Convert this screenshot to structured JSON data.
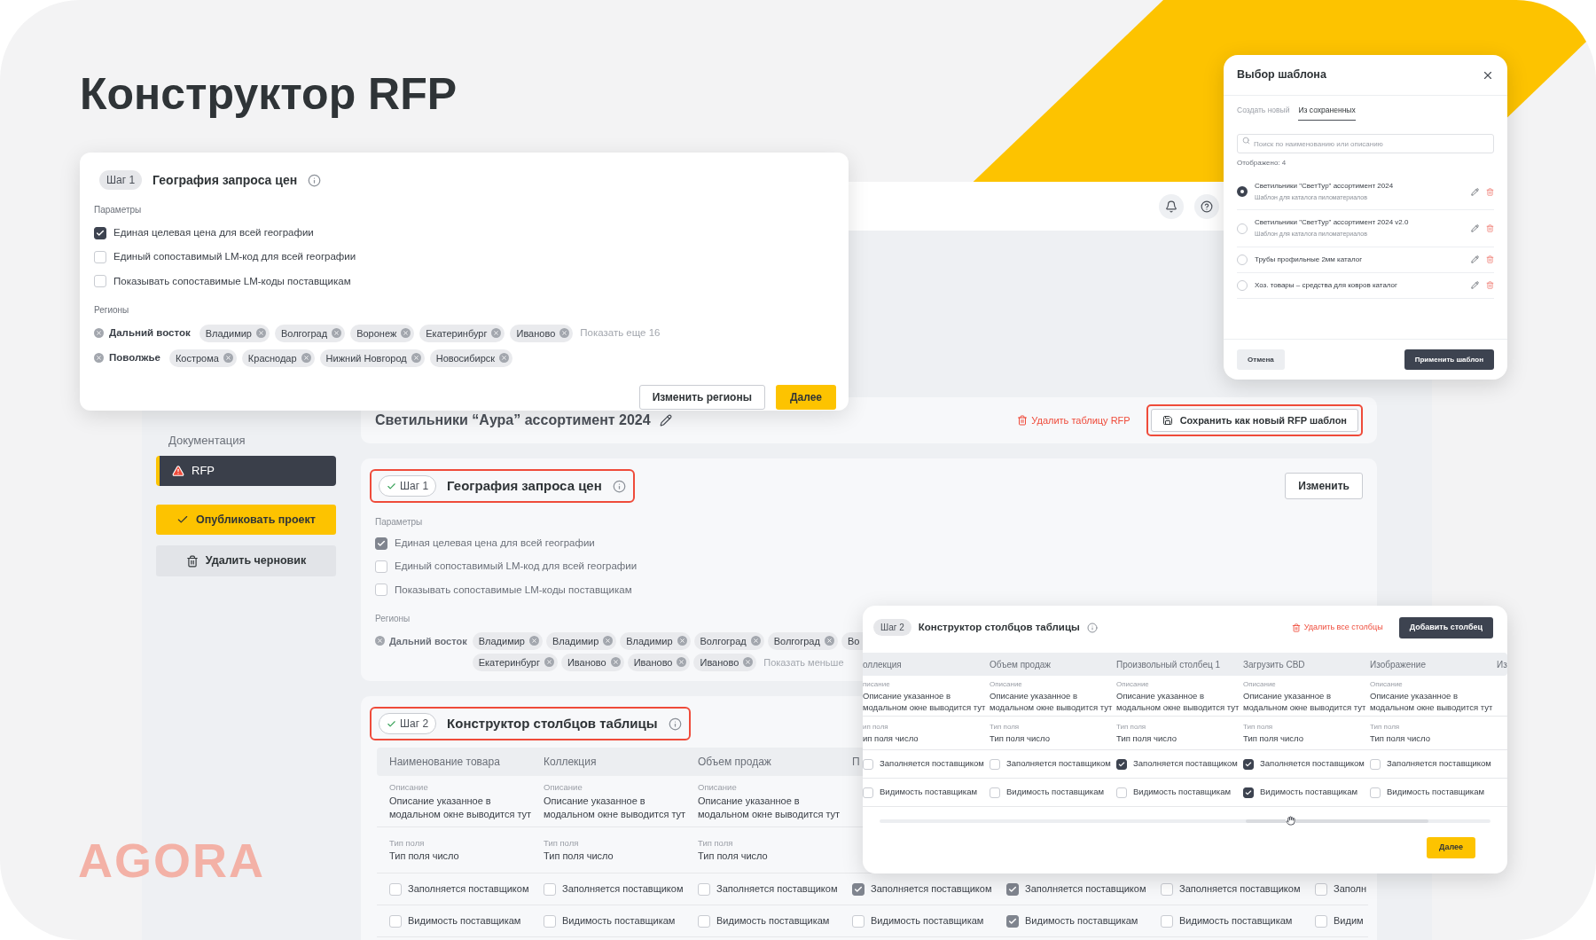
{
  "title": "Конструктор RFP",
  "logo": "AGORA",
  "app": {
    "sidebar": {
      "items": [
        {
          "label": "Документация",
          "selected": false,
          "kind": "link"
        },
        {
          "label": "RFP",
          "selected": true,
          "kind": "warning"
        }
      ],
      "publish_button": "Опубликовать проект",
      "delete_button": "Удалить черновик"
    },
    "header": {
      "title": "Светильники “Аура” ассортимент 2024",
      "delete_link": "Удалить таблицу RFP",
      "save_button": {
        "label": "Сохранить как новый RFP шаблон",
        "highlighted": true
      }
    },
    "step1": {
      "badge": "Шаг 1",
      "done": true,
      "highlighted": true,
      "title": "География запроса цен",
      "edit_button": "Изменить",
      "params_label": "Параметры",
      "options": [
        {
          "label": "Единая целевая цена для всей географии",
          "checked": true
        },
        {
          "label": "Единый сопоставимый LM-код для всей географии",
          "checked": false
        },
        {
          "label": "Показывать сопоставимые LM-коды поставщикам",
          "checked": false
        }
      ],
      "regions_label": "Регионы",
      "region": "Дальний восток",
      "chip_rows": [
        [
          "Владимир",
          "Владимир",
          "Владимир",
          "Волгоград",
          "Волгоград",
          "Во"
        ],
        [
          "Екатеринбург",
          "Иваново",
          "Иваново",
          "Иваново"
        ]
      ],
      "less": "Показать меньше"
    },
    "step2": {
      "badge": "Шаг 2",
      "done": true,
      "highlighted": true,
      "title": "Конструктор столбцов таблицы",
      "columns": [
        {
          "header": "Наименование товара",
          "description_label": "Описание",
          "description": "Описание указанное в модальном окне выводится тут",
          "type_label": "Тип поля",
          "type": "Тип поля число",
          "filled_label": "Заполняется поставщиком",
          "filled": false,
          "visible_label": "Видимость поставщикам",
          "visible": false
        },
        {
          "header": "Коллекция",
          "description_label": "Описание",
          "description": "Описание указанное в модальном окне выводится тут",
          "type_label": "Тип поля",
          "type": "Тип поля число",
          "filled_label": "Заполняется поставщиком",
          "filled": false,
          "visible_label": "Видимость поставщикам",
          "visible": false
        },
        {
          "header": "Объем продаж",
          "description_label": "Описание",
          "description": "Описание указанное в модальном окне выводится тут",
          "type_label": "Тип поля",
          "type": "Тип поля число",
          "filled_label": "Заполняется поставщиком",
          "filled": false,
          "visible_label": "Видимость поставщикам",
          "visible": false
        },
        {
          "header": "П",
          "filled_label": "Заполняется поставщиком",
          "filled": true,
          "visible_label": "Видимость поставщикам",
          "visible": false
        },
        {
          "filled_label": "Заполняется поставщиком",
          "filled": true,
          "visible_label": "Видимость поставщикам",
          "visible": true
        },
        {
          "filled_label": "Заполняется поставщиком",
          "filled": false,
          "visible_label": "Видимость поставщикам",
          "visible": false
        },
        {
          "filled_label": "Заполн",
          "filled": false,
          "visible_label": "Видим",
          "visible": false
        }
      ]
    }
  },
  "geo_card": {
    "badge": "Шаг 1",
    "done": false,
    "title": "География запроса цен",
    "params_label": "Параметры",
    "options": [
      {
        "label": "Единая целевая цена для всей географии",
        "checked": true
      },
      {
        "label": "Единый сопоставимый LM-код для всей географии",
        "checked": false
      },
      {
        "label": "Показывать сопоставимые LM-коды поставщикам",
        "checked": false
      }
    ],
    "regions_label": "Регионы",
    "regions": [
      {
        "name": "Дальний восток",
        "chips": [
          "Владимир",
          "Волгоград",
          "Воронеж",
          "Екатеринбург",
          "Иваново"
        ],
        "more": "Показать еще 16"
      },
      {
        "name": "Поволжье",
        "chips": [
          "Кострома",
          "Краснодар",
          "Нижний Новгород",
          "Новосибирск"
        ]
      }
    ],
    "buttons": [
      {
        "label": "Изменить регионы",
        "kind": "outline"
      },
      {
        "label": "Далее",
        "kind": "primary"
      }
    ]
  },
  "template_modal": {
    "title": "Выбор шаблона",
    "tabs": [
      {
        "label": "Создать новый",
        "selected": false
      },
      {
        "label": "Из сохраненных",
        "selected": true
      }
    ],
    "search": {
      "placeholder": "Поиск по наименованию или описанию"
    },
    "count": "Отображено: 4",
    "templates": [
      {
        "name": "Светильники \"СветТур\" ассортимент 2024",
        "description": "Шаблон для каталога пиломатериалов",
        "selected": true
      },
      {
        "name": "Светильники \"СветТур\" ассортимент 2024 v2.0",
        "description": "Шаблон для каталога пиломатериалов",
        "selected": false
      },
      {
        "name": "Трубы профильные 2мм каталог",
        "selected": false
      },
      {
        "name": "Хоз. товары – средства для ковров каталог",
        "selected": false
      }
    ],
    "cancel_button": "Отмена",
    "apply_button": "Применить шаблон"
  },
  "columns_card": {
    "badge": "Шаг 2",
    "done": false,
    "title": "Конструктор столбцов таблицы",
    "delete_link": "Удалить все столбцы",
    "add_button": "Добавить столбец",
    "columns": [
      {
        "header": "оллекция",
        "description_label": "писание",
        "description": "Описание указанное в модальном окне выводится тут",
        "type_label": "ип поля",
        "type": "ип поля число",
        "filled_label": "Заполняется поставщиком",
        "filled": false,
        "visible_label": "Видимость поставщикам",
        "visible": false
      },
      {
        "header": "Объем продаж",
        "description_label": "Описание",
        "description": "Описание указанное в модальном окне выводится тут",
        "type_label": "Тип поля",
        "type": "Тип поля число",
        "filled_label": "Заполняется поставщиком",
        "filled": false,
        "visible_label": "Видимость поставщикам",
        "visible": false
      },
      {
        "header": "Произвольный столбец 1",
        "description_label": "Описание",
        "description": "Описание указанное в модальном окне выводится тут",
        "type_label": "Тип поля",
        "type": "Тип поля число",
        "filled_label": "Заполняется поставщиком",
        "filled": true,
        "visible_label": "Видимость поставщикам",
        "visible": false
      },
      {
        "header": "Загрузить CBD",
        "description_label": "Описание",
        "description": "Описание указанное в модальном окне выводится тут",
        "type_label": "Тип поля",
        "type": "Тип поля число",
        "filled_label": "Заполняется поставщиком",
        "filled": true,
        "visible_label": "Видимость поставщикам",
        "visible": true
      },
      {
        "header": "Изображение",
        "description_label": "Описание",
        "description": "Описание указанное в модальном окне выводится тут",
        "type_label": "Тип поля",
        "type": "Тип поля число",
        "filled_label": "Заполняется поставщиком",
        "filled": false,
        "visible_label": "Видимость поставщикам",
        "visible": false
      },
      {
        "header": "Из"
      }
    ],
    "next_button": "Далее"
  }
}
